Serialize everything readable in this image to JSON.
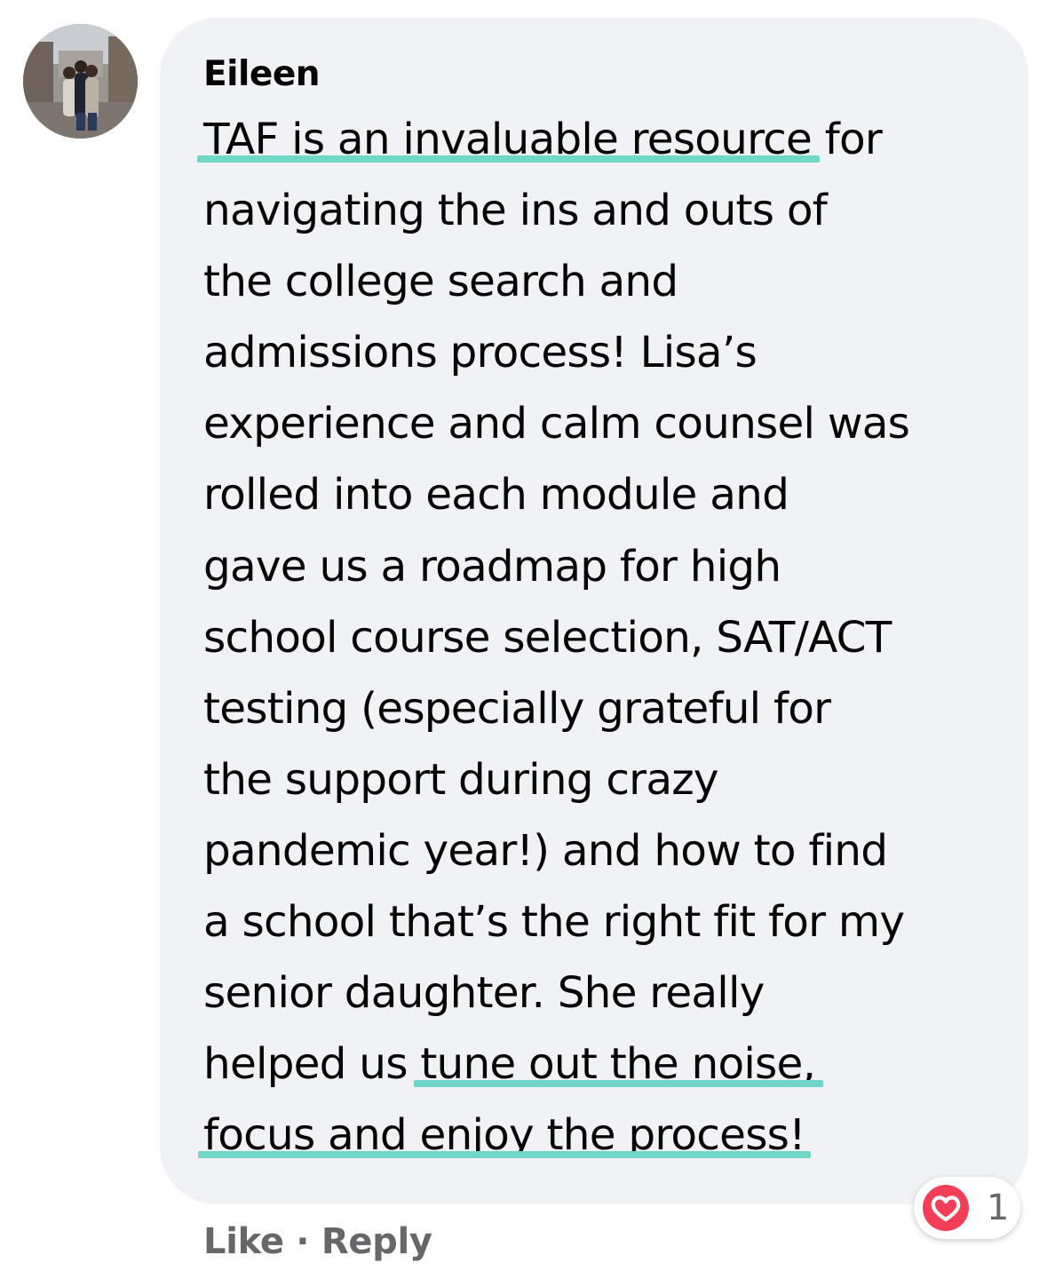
{
  "comment": {
    "author": "Eileen",
    "lines": [
      [
        "TAF is an invaluable resource",
        " for"
      ],
      [
        "navigating the ins and outs of"
      ],
      [
        "the college search and"
      ],
      [
        "admissions process! Lisa’s"
      ],
      [
        "experience and calm counsel was"
      ],
      [
        "rolled into each module and"
      ],
      [
        "gave us a roadmap for high"
      ],
      [
        "school course selection, SAT/ACT"
      ],
      [
        "testing (especially grateful for"
      ],
      [
        "the support during crazy"
      ],
      [
        "pandemic year!) and how to find"
      ],
      [
        "a school that’s the right fit for my"
      ],
      [
        "senior daughter. She really"
      ],
      [
        "helped us ",
        "tune out the noise,"
      ],
      [
        "focus and enjoy the process!"
      ]
    ],
    "highlight_color": "#6fd6c8"
  },
  "reaction": {
    "icon": "heart-reaction-icon",
    "color": "#f33e58",
    "count": "1"
  },
  "actions": {
    "like_label": "Like",
    "separator": "·",
    "reply_label": "Reply"
  }
}
